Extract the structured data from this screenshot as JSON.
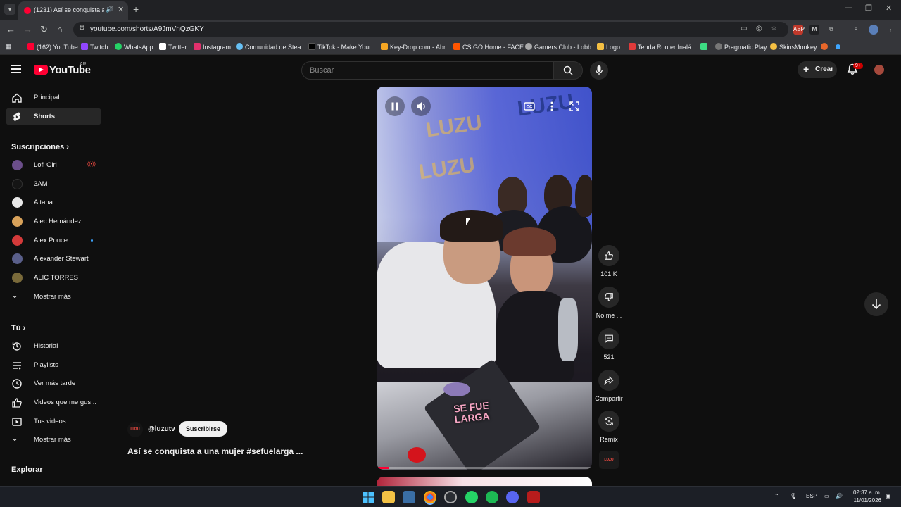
{
  "browser": {
    "tab_title": "(1231) Así se conquista a una mujer",
    "url": "youtube.com/shorts/A9JmVnQzGKY",
    "new_tab": "+",
    "window_controls": [
      "—",
      "❐",
      "✕"
    ]
  },
  "bookmarks": [
    {
      "label": "(162) YouTube",
      "color": "#ff0033"
    },
    {
      "label": "Twitch",
      "color": "#9146ff"
    },
    {
      "label": "WhatsApp",
      "color": "#25d366"
    },
    {
      "label": "Twitter",
      "color": "#ffffff"
    },
    {
      "label": "Instagram",
      "color": "#e1306c"
    },
    {
      "label": "Comunidad de Stea...",
      "color": "#1b2838"
    },
    {
      "label": "TikTok - Make Your...",
      "color": "#000000"
    },
    {
      "label": "Key-Drop.com - Abr...",
      "color": "#f5a623"
    },
    {
      "label": "CS:GO Home - FACE...",
      "color": "#ff5500"
    },
    {
      "label": "Gamers Club - Lobb...",
      "color": "#aaaaaa"
    },
    {
      "label": "Logo",
      "color": "#f5c043"
    },
    {
      "label": "Tenda Router Inalá...",
      "color": "#e03a3a"
    },
    {
      "label": "",
      "color": "#3ddc84"
    },
    {
      "label": "Pragmatic Play",
      "color": "#888888"
    },
    {
      "label": "SkinsMonkey",
      "color": "#f5c043"
    }
  ],
  "youtube": {
    "logo_text": "YouTube",
    "country": "AR",
    "search_placeholder": "Buscar",
    "create_label": "Crear",
    "notifications_badge": "9+"
  },
  "sidebar": {
    "main": [
      {
        "label": "Principal",
        "icon": "home-icon"
      },
      {
        "label": "Shorts",
        "icon": "shorts-icon",
        "active": true
      }
    ],
    "subs_header": "Suscripciones",
    "subscriptions": [
      {
        "label": "Lofi Girl",
        "color": "#6b4e8a",
        "live": true
      },
      {
        "label": "3AM",
        "color": "#151515"
      },
      {
        "label": "Aitana",
        "color": "#e8e8e8"
      },
      {
        "label": "Alec Hernández",
        "color": "#d8a25a"
      },
      {
        "label": "Alex Ponce",
        "color": "#d43a3a",
        "new": true
      },
      {
        "label": "Alexander Stewart",
        "color": "#5a5f8a"
      },
      {
        "label": "ALIC TORRES",
        "color": "#7a6a3a"
      }
    ],
    "show_more": "Mostrar más",
    "you_header": "Tú",
    "you_items": [
      {
        "label": "Historial",
        "icon": "history-icon"
      },
      {
        "label": "Playlists",
        "icon": "playlists-icon"
      },
      {
        "label": "Ver más tarde",
        "icon": "watch-later-icon"
      },
      {
        "label": "Videos que me gus...",
        "icon": "liked-icon"
      },
      {
        "label": "Tus videos",
        "icon": "your-videos-icon"
      }
    ],
    "show_more_2": "Mostrar más",
    "explore_header": "Explorar"
  },
  "short": {
    "channel": "@luzutv",
    "subscribe": "Suscribirse",
    "title": "Así se conquista a una mujer #sefuelarga ...",
    "sign_text": "SE FUE\nLARGA",
    "progress": 0.06,
    "actions": {
      "like": "101 K",
      "dislike": "No me ...",
      "comments": "521",
      "share": "Compartir",
      "remix": "Remix"
    }
  },
  "taskbar": {
    "lang": "ESP",
    "time": "02:37 a. m.",
    "date": "11/01/2026"
  }
}
